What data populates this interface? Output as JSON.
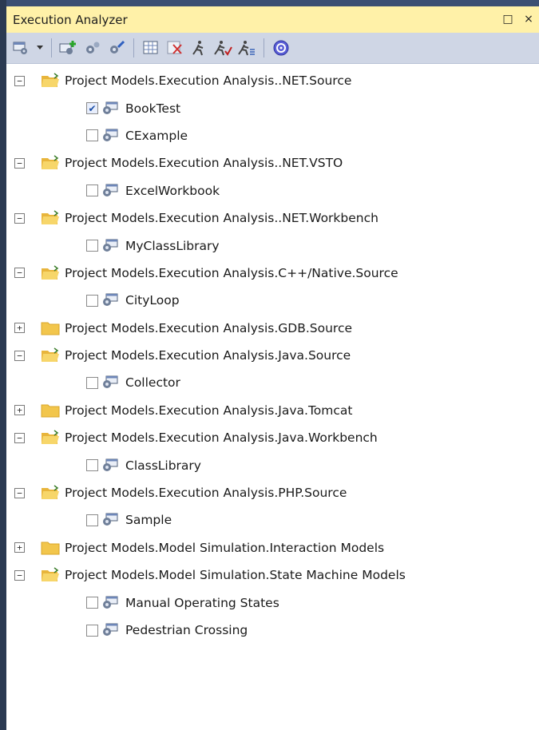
{
  "window": {
    "title": "Execution Analyzer",
    "buttons": {
      "restore": "□",
      "close": "×"
    }
  },
  "toolbar": {
    "icons": [
      "manage-scripts-icon",
      "dropdown-arrow-icon",
      "new-script-icon",
      "copy-script-icon",
      "edit-script-icon",
      "analyzer-grid-icon",
      "delete-icon",
      "run-icon",
      "run-check-icon",
      "run-list-icon",
      "help-icon"
    ]
  },
  "tree": [
    {
      "type": "package",
      "expanded": true,
      "label": "Project Models.Execution Analysis..NET.Source"
    },
    {
      "type": "script",
      "checked": true,
      "label": "BookTest"
    },
    {
      "type": "script",
      "checked": false,
      "label": "CExample"
    },
    {
      "type": "package",
      "expanded": true,
      "label": "Project Models.Execution Analysis..NET.VSTO"
    },
    {
      "type": "script",
      "checked": false,
      "label": "ExcelWorkbook"
    },
    {
      "type": "package",
      "expanded": true,
      "label": "Project Models.Execution Analysis..NET.Workbench"
    },
    {
      "type": "script",
      "checked": false,
      "label": "MyClassLibrary"
    },
    {
      "type": "package",
      "expanded": true,
      "label": "Project Models.Execution Analysis.C++/Native.Source"
    },
    {
      "type": "script",
      "checked": false,
      "label": "CityLoop"
    },
    {
      "type": "package",
      "expanded": false,
      "label": "Project Models.Execution Analysis.GDB.Source"
    },
    {
      "type": "package",
      "expanded": true,
      "label": "Project Models.Execution Analysis.Java.Source"
    },
    {
      "type": "script",
      "checked": false,
      "label": "Collector"
    },
    {
      "type": "package",
      "expanded": false,
      "label": "Project Models.Execution Analysis.Java.Tomcat"
    },
    {
      "type": "package",
      "expanded": true,
      "label": "Project Models.Execution Analysis.Java.Workbench"
    },
    {
      "type": "script",
      "checked": false,
      "label": "ClassLibrary"
    },
    {
      "type": "package",
      "expanded": true,
      "label": "Project Models.Execution Analysis.PHP.Source"
    },
    {
      "type": "script",
      "checked": false,
      "label": "Sample"
    },
    {
      "type": "package",
      "expanded": false,
      "label": "Project Models.Model Simulation.Interaction Models"
    },
    {
      "type": "package",
      "expanded": true,
      "label": "Project Models.Model Simulation.State Machine Models"
    },
    {
      "type": "script",
      "checked": false,
      "label": "Manual Operating States"
    },
    {
      "type": "script",
      "checked": false,
      "label": "Pedestrian Crossing"
    }
  ],
  "colors": {
    "titlebar": "#fff1a8",
    "toolbar": "#cfd6e5",
    "frame": "#2b3a52",
    "folder": "#f2c64c",
    "check": "#1c4fa8"
  }
}
